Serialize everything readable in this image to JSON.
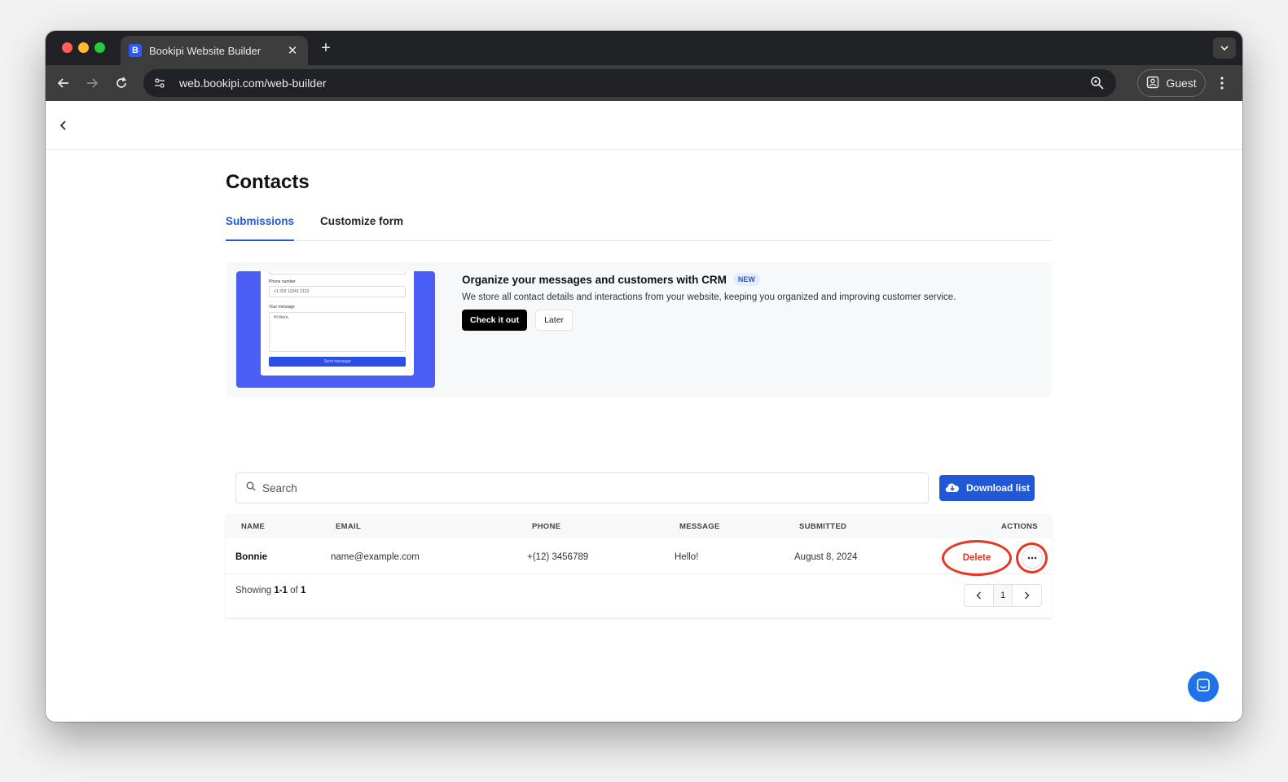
{
  "browser": {
    "tab_title": "Bookipi Website Builder",
    "tab_favicon": "B",
    "url": "web.bookipi.com/web-builder",
    "profile_label": "Guest"
  },
  "page": {
    "title": "Contacts",
    "tabs": [
      {
        "label": "Submissions",
        "active": true
      },
      {
        "label": "Customize form",
        "active": false
      }
    ]
  },
  "banner": {
    "title": "Organize your messages and customers with CRM",
    "badge": "NEW",
    "description": "We store all contact details and interactions from your website, keeping you organized and improving customer service.",
    "primary_label": "Check it out",
    "secondary_label": "Later",
    "mock_form": {
      "phone_label": "Phone number",
      "phone_value": "+1 203 12341 2122",
      "message_label": "Your message",
      "message_value": "Hi there,",
      "button_label": "Send message"
    }
  },
  "search": {
    "placeholder": "Search"
  },
  "download_label": "Download list",
  "table": {
    "columns": [
      "NAME",
      "EMAIL",
      "PHONE",
      "MESSAGE",
      "SUBMITTED",
      "ACTIONS"
    ],
    "rows": [
      {
        "name": "Bonnie",
        "email": "name@example.com",
        "phone": "+(12) 3456789",
        "message": "Hello!",
        "submitted": "August 8, 2024",
        "delete_label": "Delete"
      }
    ]
  },
  "footer": {
    "showing_prefix": "Showing",
    "range": "1-1",
    "of_word": "of",
    "total": "1",
    "current_page": "1"
  },
  "colors": {
    "accent": "#2058d8",
    "highlight_ring": "#e53722"
  }
}
